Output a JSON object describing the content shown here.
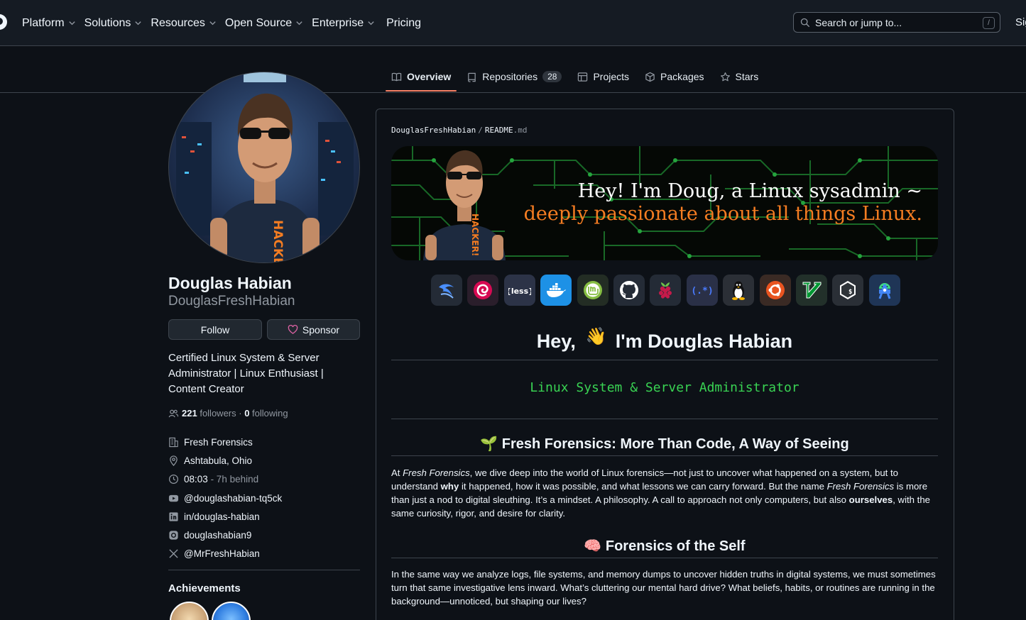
{
  "header": {
    "nav": [
      {
        "label": "Platform",
        "dropdown": true
      },
      {
        "label": "Solutions",
        "dropdown": true
      },
      {
        "label": "Resources",
        "dropdown": true
      },
      {
        "label": "Open Source",
        "dropdown": true
      },
      {
        "label": "Enterprise",
        "dropdown": true
      },
      {
        "label": "Pricing",
        "dropdown": false
      }
    ],
    "search_placeholder": "Search or jump to...",
    "search_shortcut": "/",
    "sign_in": "Sign in"
  },
  "tabs": [
    {
      "label": "Overview",
      "icon": "book-icon",
      "active": true
    },
    {
      "label": "Repositories",
      "icon": "repo-icon",
      "count": "28"
    },
    {
      "label": "Projects",
      "icon": "table-icon"
    },
    {
      "label": "Packages",
      "icon": "package-icon"
    },
    {
      "label": "Stars",
      "icon": "star-icon"
    }
  ],
  "profile": {
    "name": "Douglas Habian",
    "login": "DouglasFreshHabian",
    "follow_label": "Follow",
    "sponsor_label": "Sponsor",
    "bio": "Certified Linux System & Server Administrator | Linux Enthusiast | Content Creator",
    "followers_count": "221",
    "followers_label": "followers",
    "following_count": "0",
    "following_label": "following",
    "company": "Fresh Forensics",
    "location": "Ashtabula, Ohio",
    "local_time": "08:03",
    "time_offset": "- 7h behind",
    "youtube": "@douglashabian-tq5ck",
    "linkedin": "in/douglas-habian",
    "instagram": "douglashabian9",
    "x": "@MrFreshHabian",
    "achievements_title": "Achievements"
  },
  "readme": {
    "owner": "DouglasFreshHabian",
    "separator": "/",
    "file_base": "README",
    "file_ext": ".md",
    "banner_line1": "Hey! I'm Doug, a Linux sysadmin ~",
    "banner_line2": "deeply passionate about all things Linux.",
    "banner_shirt_text": "HACKER!",
    "less_icon_text": "{less}",
    "regex_icon_text": "(.*)",
    "tech_icons": [
      "kali-linux-icon",
      "debian-icon",
      "less-icon",
      "docker-icon",
      "linux-mint-icon",
      "github-icon",
      "raspberry-pi-icon",
      "regex-icon",
      "linux-tux-icon",
      "ubuntu-icon",
      "vim-icon",
      "bash-icon",
      "android-studio-icon"
    ],
    "greeting_prefix": "Hey,",
    "greeting_emoji": "👋",
    "greeting_suffix": "I'm Douglas Habian",
    "typing_text": "Linux System & Server Administrator",
    "section1_emoji": "🌱",
    "section1_title": "Fresh Forensics: More Than Code, A Way of Seeing",
    "section1_para": {
      "t1": "At ",
      "em1": "Fresh Forensics",
      "t2": ", we dive deep into the world of Linux forensics—not just to uncover what happened on a system, but to understand ",
      "b1": "why",
      "t3": " it happened, how it was possible, and what lessons we can carry forward. But the name ",
      "em2": "Fresh Forensics",
      "t4": " is more than just a nod to digital sleuthing. It’s a mindset. A philosophy. A call to approach not only computers, but also ",
      "b2": "ourselves",
      "t5": ", with the same curiosity, rigor, and desire for clarity."
    },
    "section2_emoji": "🧠",
    "section2_title": "Forensics of the Self",
    "section2_para": "In the same way we analyze logs, file systems, and memory dumps to uncover hidden truths in digital systems, we must sometimes turn that same investigative lens inward. What’s cluttering our mental hard drive? What beliefs, habits, or routines are running in the background—unnoticed, but shaping our lives?"
  },
  "colors": {
    "accent_tab": "#f78166",
    "typing_green": "#39d353",
    "banner_orange": "#f57d22",
    "sponsor_pink": "#db61a2"
  }
}
